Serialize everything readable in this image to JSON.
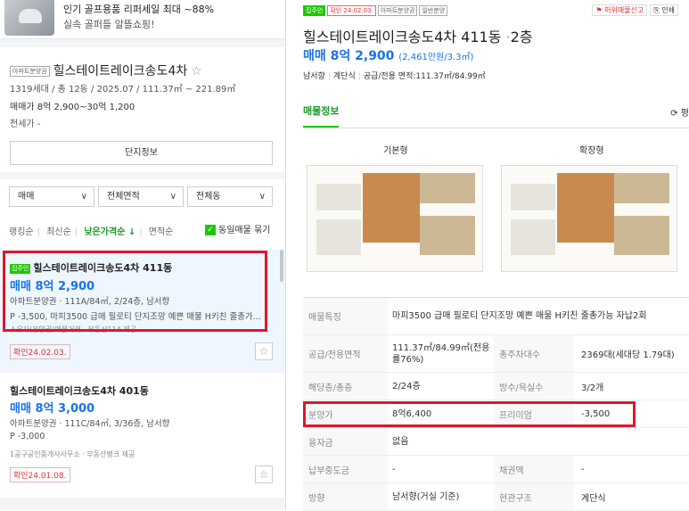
{
  "ad": {
    "line1": "인기 골프용품 리퍼세일 최대 ~88%",
    "line2": "실속 골퍼들 알뜰쇼핑!"
  },
  "summary": {
    "badge": "아파트분양권",
    "title": "힐스테이트레이크송도4차",
    "star": "☆",
    "line1": "1319세대 / 총 12동 / 2025.07 / 111.37㎡ ~ 221.89㎡",
    "line2": "매매가 8억 2,900~30억 1,200",
    "line3": "전세가 -",
    "info_button": "단지정보"
  },
  "filters": {
    "deal": "매매",
    "area": "전체면적",
    "building": "전체동",
    "chevron": "∨",
    "sorts": [
      "랭킹순",
      "최신순",
      "낮은가격순 ↓",
      "면적순"
    ],
    "active_sort": 2,
    "dup_label": "동일매물 묶기",
    "check": "✓"
  },
  "listings": [
    {
      "tag": "집주인",
      "title": "힐스테이트레이크송도4차 411동",
      "price": "매매 8억 2,900",
      "spec": "아파트분양권 · 111A/84㎡, 2/24층, 남서향",
      "desc": "P -3,500, 마피3500 급매 필로티 단지조망 예쁜 매물 H키친 줄총가...",
      "agent": "소유자(분양권)매물거래 · 부동산114 제공",
      "confirm": "확인24.02.03.",
      "star": "☆"
    },
    {
      "tag": "",
      "title": "힐스테이트레이크송도4차 401동",
      "price": "매매 8억 3,000",
      "spec": "아파트분양권 · 111C/84㎡, 3/36층, 남서향",
      "desc": "P -3,000",
      "agent": "1공구공인중개사사무소 · 부동산뱅크 제공",
      "confirm": "확인24.01.08.",
      "star": "☆"
    }
  ],
  "detail": {
    "badges": [
      "집주인",
      "확인 24.02.03.",
      "아파트분양권",
      "일반분양"
    ],
    "report": "⚑ 허위매물신고",
    "share": "⎘ 인쇄",
    "title": "힐스테이트레이크송도4차 411동",
    "floor": "2층",
    "price": "매매 8억 2,900",
    "price_unit": "(2,461만원/3.3㎡)",
    "sub": [
      "남서향",
      "계단식",
      "공급/전용 면적:111.37㎡/84.99㎡"
    ],
    "tab": "매물정보",
    "tab_right": "⟳ 평",
    "plan_labels": [
      "기본형",
      "확장형"
    ],
    "rows": [
      {
        "k1": "매물특징",
        "v1": "마피3500 급매 필로티 단지조망 예쁜 매물 H키친 줄총가능 자납2회",
        "k2": "",
        "v2": ""
      },
      {
        "k1": "공급/전용면적",
        "v1": "111.37㎡/84.99㎡(전용률76%)",
        "k2": "총주차대수",
        "v2": "2369대(세대당 1.79대)"
      },
      {
        "k1": "해당층/총층",
        "v1": "2/24층",
        "k2": "방수/욕실수",
        "v2": "3/2개"
      },
      {
        "k1": "분양가",
        "v1": "8억6,400",
        "k2": "프리미엄",
        "v2": "-3,500"
      },
      {
        "k1": "융자금",
        "v1": "없음",
        "k2": "",
        "v2": ""
      },
      {
        "k1": "납부중도금",
        "v1": "-",
        "k2": "채권액",
        "v2": "-"
      },
      {
        "k1": "방향",
        "v1": "남서향(거실 기준)",
        "k2": "현관구조",
        "v2": "계단식"
      }
    ]
  }
}
